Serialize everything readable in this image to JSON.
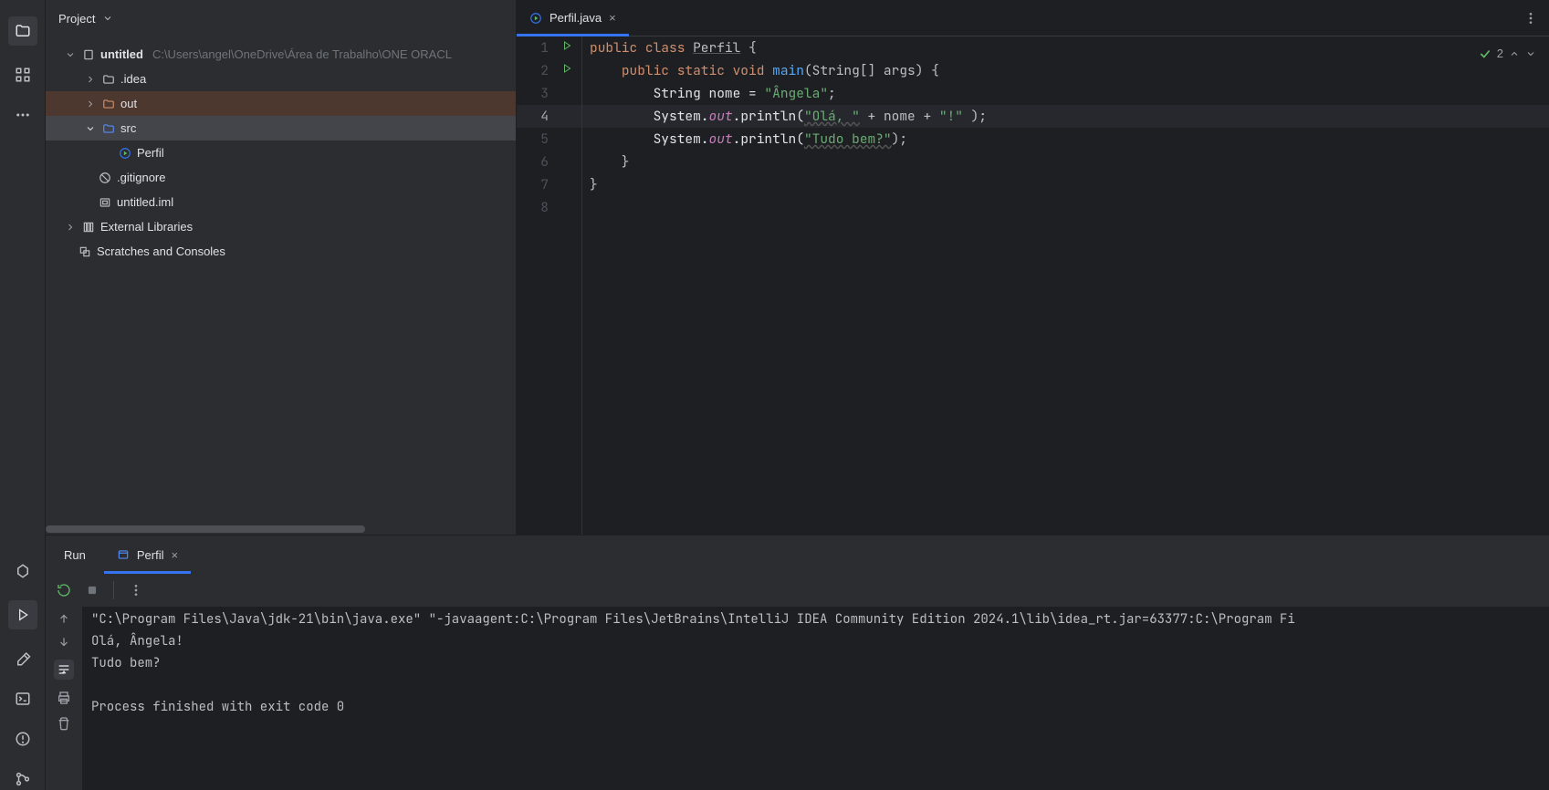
{
  "project_panel": {
    "title": "Project",
    "tree": {
      "root_name": "untitled",
      "root_path": "C:\\Users\\angel\\OneDrive\\Área de Trabalho\\ONE ORACL",
      "idea": ".idea",
      "out": "out",
      "src": "src",
      "perfil": "Perfil",
      "gitignore": ".gitignore",
      "iml": "untitled.iml",
      "ext_lib": "External Libraries",
      "scratches": "Scratches and Consoles"
    }
  },
  "editor": {
    "tab_name": "Perfil.java",
    "inspections_count": "2",
    "code": {
      "l1_pre": "public",
      "l1_class": "class",
      "l1_name": "Perfil",
      "l1_brace": " {",
      "l2_indent": "    ",
      "l2_mods": "public static void",
      "l2_main": "main",
      "l2_params": "(String[] args) {",
      "l3_indent": "        ",
      "l3_a": "String nome = ",
      "l3_str": "\"Ângela\"",
      "l3_semi": ";",
      "l4_indent": "        ",
      "l4_sys": "System.",
      "l4_out": "out",
      "l4_call": ".println(",
      "l4_str1": "\"Olá, \"",
      "l4_plus1": " + nome + ",
      "l4_str2": "\"!\"",
      "l4_end": " );",
      "l5_indent": "        ",
      "l5_sys": "System.",
      "l5_out": "out",
      "l5_call": ".println(",
      "l5_str": "\"Tudo bem?\"",
      "l5_end": ");",
      "l6": "    }",
      "l7": "}",
      "l8": ""
    }
  },
  "run": {
    "label": "Run",
    "config_name": "Perfil",
    "output": {
      "cmd": "\"C:\\Program Files\\Java\\jdk-21\\bin\\java.exe\" \"-javaagent:C:\\Program Files\\JetBrains\\IntelliJ IDEA Community Edition 2024.1\\lib\\idea_rt.jar=63377:C:\\Program Fi",
      "l1": "Olá, Ângela!",
      "l2": "Tudo bem?",
      "l3": "",
      "exit": "Process finished with exit code 0"
    }
  }
}
